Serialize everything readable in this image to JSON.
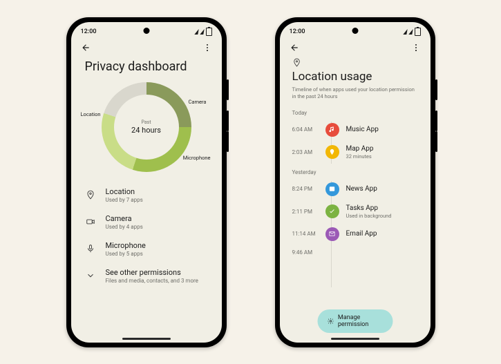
{
  "status": {
    "time": "12:00"
  },
  "phone1": {
    "title": "Privacy dashboard",
    "donut": {
      "center_top": "Past",
      "center_main": "24 hours",
      "labels": {
        "location": "Location",
        "camera": "Camera",
        "microphone": "Microphone"
      }
    },
    "rows": [
      {
        "label": "Location",
        "sub": "Used by 7 apps"
      },
      {
        "label": "Camera",
        "sub": "Used by 4 apps"
      },
      {
        "label": "Microphone",
        "sub": "Used by 5 apps"
      },
      {
        "label": "See other permissions",
        "sub": "Files and media, contacts, and 3 more"
      }
    ]
  },
  "phone2": {
    "title": "Location usage",
    "subtitle": "Timeline of when apps used your location permission in the past 24 hours",
    "sections": {
      "today": "Today",
      "yesterday": "Yesterday"
    },
    "today": [
      {
        "time": "6:04 AM",
        "app": "Music App",
        "sub": "",
        "color": "red"
      },
      {
        "time": "2:03 AM",
        "app": "Map App",
        "sub": "32 minutes",
        "color": "yellow"
      }
    ],
    "yesterday": [
      {
        "time": "8:24 PM",
        "app": "News App",
        "sub": "",
        "color": "blue"
      },
      {
        "time": "2:11 PM",
        "app": "Tasks App",
        "sub": "Used in background",
        "color": "grn"
      },
      {
        "time": "11:14 AM",
        "app": "Email App",
        "sub": "",
        "color": "purple"
      }
    ],
    "cutoff_time": "9:46 AM",
    "manage_button": "Manage permission"
  }
}
